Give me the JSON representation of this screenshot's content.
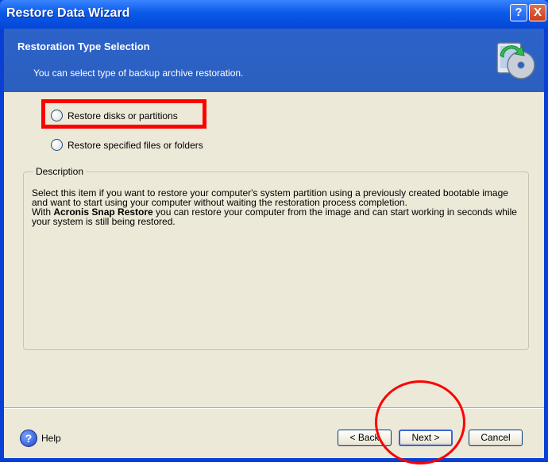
{
  "window": {
    "title": "Restore Data Wizard",
    "help_glyph": "?",
    "close_glyph": "X"
  },
  "header": {
    "title": "Restoration Type Selection",
    "subtitle": "You can select type of backup archive restoration.",
    "icon": "restore-wizard-icon"
  },
  "options": [
    {
      "label": "Restore disks or partitions",
      "selected": false
    },
    {
      "label": "Restore specified files or folders",
      "selected": false
    }
  ],
  "description": {
    "legend": "Description",
    "line1": "Select this item if you want to restore your computer's system partition using a previously created bootable image and want to start using your computer without waiting the restoration process completion.",
    "line2_prefix": "With ",
    "line2_bold": "Acronis Snap Restore",
    "line2_suffix": " you can restore your computer from the image and can start working in seconds while your system is still being restored."
  },
  "footer": {
    "help_label": "Help",
    "help_glyph": "?",
    "back_label": "< Back",
    "next_label": "Next >",
    "cancel_label": "Cancel"
  },
  "colors": {
    "titlebar": "#0a5ae8",
    "header": "#2c63c9",
    "client": "#ece9d8",
    "annotation": "#ff0000"
  }
}
